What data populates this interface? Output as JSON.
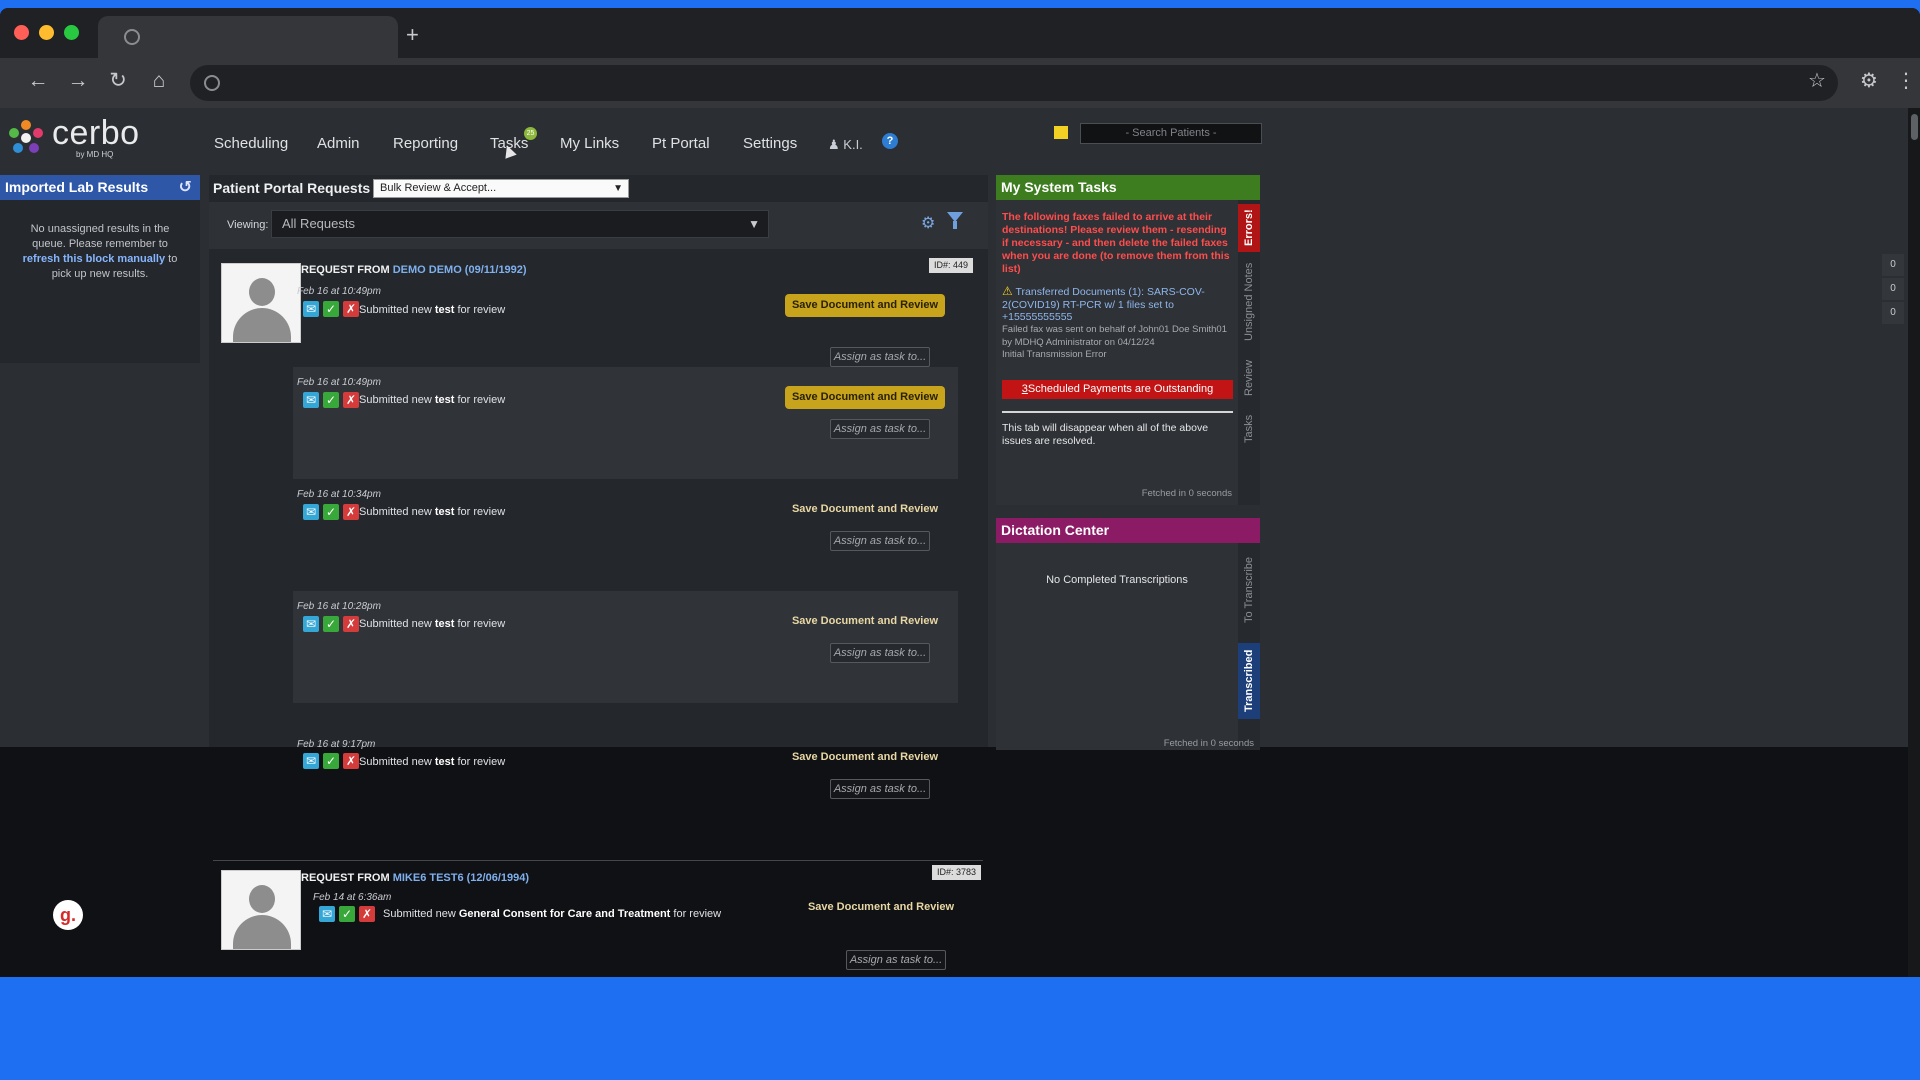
{
  "browser": {
    "new_tab": "+",
    "icons": [
      "back-icon",
      "forward-icon",
      "reload-icon",
      "home-icon",
      "globe-icon",
      "star-icon",
      "extensions-icon",
      "menu-icon"
    ]
  },
  "app": {
    "logo_text": "cerbo",
    "logo_sub": "by MD HQ",
    "nav": [
      "Scheduling",
      "Admin",
      "Reporting",
      "Tasks",
      "My Links",
      "Pt Portal",
      "Settings"
    ],
    "tasks_badge": "25",
    "user_initials": "K.I.",
    "help": "?",
    "search_placeholder": "- Search Patients -"
  },
  "left_panel": {
    "title": "Imported Lab Results",
    "msg_pre": "No unassigned results in the queue. Please remember to",
    "msg_link": "refresh this block manually",
    "msg_post": "to pick up new results."
  },
  "center": {
    "title": "Patient Portal Requests",
    "bulk_action": "Bulk Review & Accept...",
    "viewing_label": "Viewing:",
    "viewing_value": "All Requests",
    "requests": [
      {
        "label": "REQUEST FROM",
        "patient": "DEMO DEMO (09/11/1992)",
        "id": "ID#: 449",
        "entries": [
          {
            "time": "Feb 16 at 10:49pm",
            "pre": "Submitted new",
            "doc": "test",
            "post": "for review",
            "save": "Save Document and Review",
            "assign": "Assign as task to..."
          },
          {
            "time": "Feb 16 at 10:49pm",
            "pre": "Submitted new",
            "doc": "test",
            "post": "for review",
            "save": "Save Document and Review",
            "assign": "Assign as task to..."
          },
          {
            "time": "Feb 16 at 10:34pm",
            "pre": "Submitted new",
            "doc": "test",
            "post": "for review",
            "save": "Save Document and Review",
            "assign": "Assign as task to..."
          },
          {
            "time": "Feb 16 at 10:28pm",
            "pre": "Submitted new",
            "doc": "test",
            "post": "for review",
            "save": "Save Document and Review",
            "assign": "Assign as task to..."
          },
          {
            "time": "Feb 16 at 9:17pm",
            "pre": "Submitted new",
            "doc": "test",
            "post": "for review",
            "save": "Save Document and Review",
            "assign": "Assign as task to..."
          }
        ]
      },
      {
        "label": "REQUEST FROM",
        "patient": "MIKE6 TEST6 (12/06/1994)",
        "id": "ID#: 3783",
        "entries": [
          {
            "time": "Feb 14 at 6:36am",
            "pre": "Submitted new",
            "doc": "General Consent for Care and Treatment",
            "post": "for review",
            "save": "Save Document and Review",
            "assign": "Assign as task to..."
          }
        ]
      }
    ]
  },
  "system_tasks": {
    "title": "My System Tasks",
    "warning": "The following faxes failed to arrive at their destinations! Please review them - resending if necessary - and then delete the failed faxes when you are done (to remove them from this list)",
    "transfer": "Transferred Documents (1): SARS-COV-2(COVID19) RT-PCR w/ 1 files set to +15555555555",
    "detail_1": "Failed fax was sent on behalf of John01 Doe Smith01",
    "detail_2": "by MDHQ Administrator on 04/12/24",
    "detail_3": "Initial Transmission Error",
    "payments_count": "3",
    "payments_text": "Scheduled Payments are Outstanding",
    "disappear": "This tab will disappear when all of the above issues are resolved.",
    "fetched": "Fetched in 0 seconds",
    "tabs": [
      "Errors!",
      "Unsigned Notes",
      "Review",
      "Tasks"
    ]
  },
  "dictation": {
    "title": "Dictation Center",
    "empty": "No Completed Transcriptions",
    "fetched": "Fetched in 0 seconds",
    "tabs": [
      "To Transcribe",
      "Transcribed"
    ]
  },
  "counters": [
    "0",
    "0",
    "0"
  ],
  "floating_badge": "g."
}
